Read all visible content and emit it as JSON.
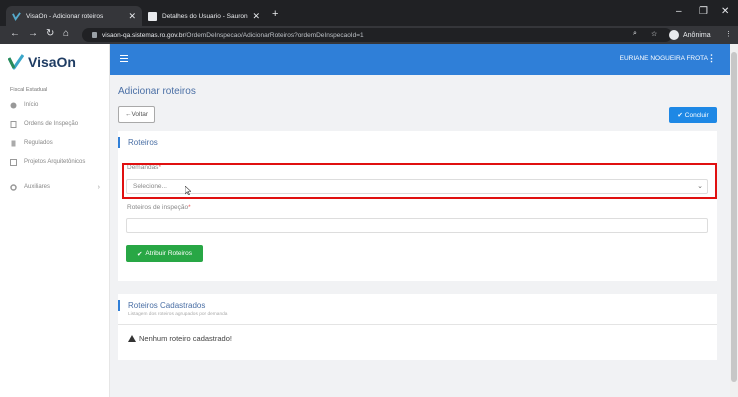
{
  "browser": {
    "tabs": [
      {
        "title": "VisaOn - Adicionar roteiros",
        "active": true,
        "icon": "visaon-favicon"
      },
      {
        "title": "Detalhes do Usuario - Sauron.Go",
        "active": false,
        "icon": "page-favicon"
      }
    ],
    "url_host": "visaon-qa.sistemas.ro.gov.br",
    "url_path": "/OrdemDeInspecao/AdicionarRoteiros?ordemDeInspecaoId=1",
    "profile_label": "Anônima",
    "window_controls": {
      "minimize": "–",
      "restore": "❐",
      "close": "✕"
    }
  },
  "app": {
    "brand": "VisaOn",
    "sidebar_subtitle": "Fiscal Estadual",
    "menu": [
      {
        "label": "Início",
        "icon": "palette-icon"
      },
      {
        "label": "Ordens de Inspeção",
        "icon": "document-icon"
      },
      {
        "label": "Regulados",
        "icon": "building-icon"
      },
      {
        "label": "Projetos Arquitetônicos",
        "icon": "blueprint-icon"
      },
      {
        "label": "Auxiliares",
        "icon": "gears-icon",
        "has_children": true
      }
    ],
    "user_name": "EURIANE NOGUEIRA FROTA",
    "accent_color": "#2f7fd8"
  },
  "page": {
    "title": "Adicionar roteiros",
    "back_label": "←Voltar",
    "conclude_label": "Concluir",
    "roteiros": {
      "section_title": "Roteiros",
      "demandas_label": "Demandas",
      "demandas_placeholder": "Selecione...",
      "roteiros_label": "Roteiros de inspeção",
      "required_mark": "*",
      "assign_button": "Atribuir Roteiros"
    },
    "cadastrados": {
      "section_title": "Roteiros Cadastrados",
      "subtitle": "Listagem dos roteiros agrupados por demanda",
      "empty_message": "Nenhum roteiro cadastrado!"
    }
  }
}
